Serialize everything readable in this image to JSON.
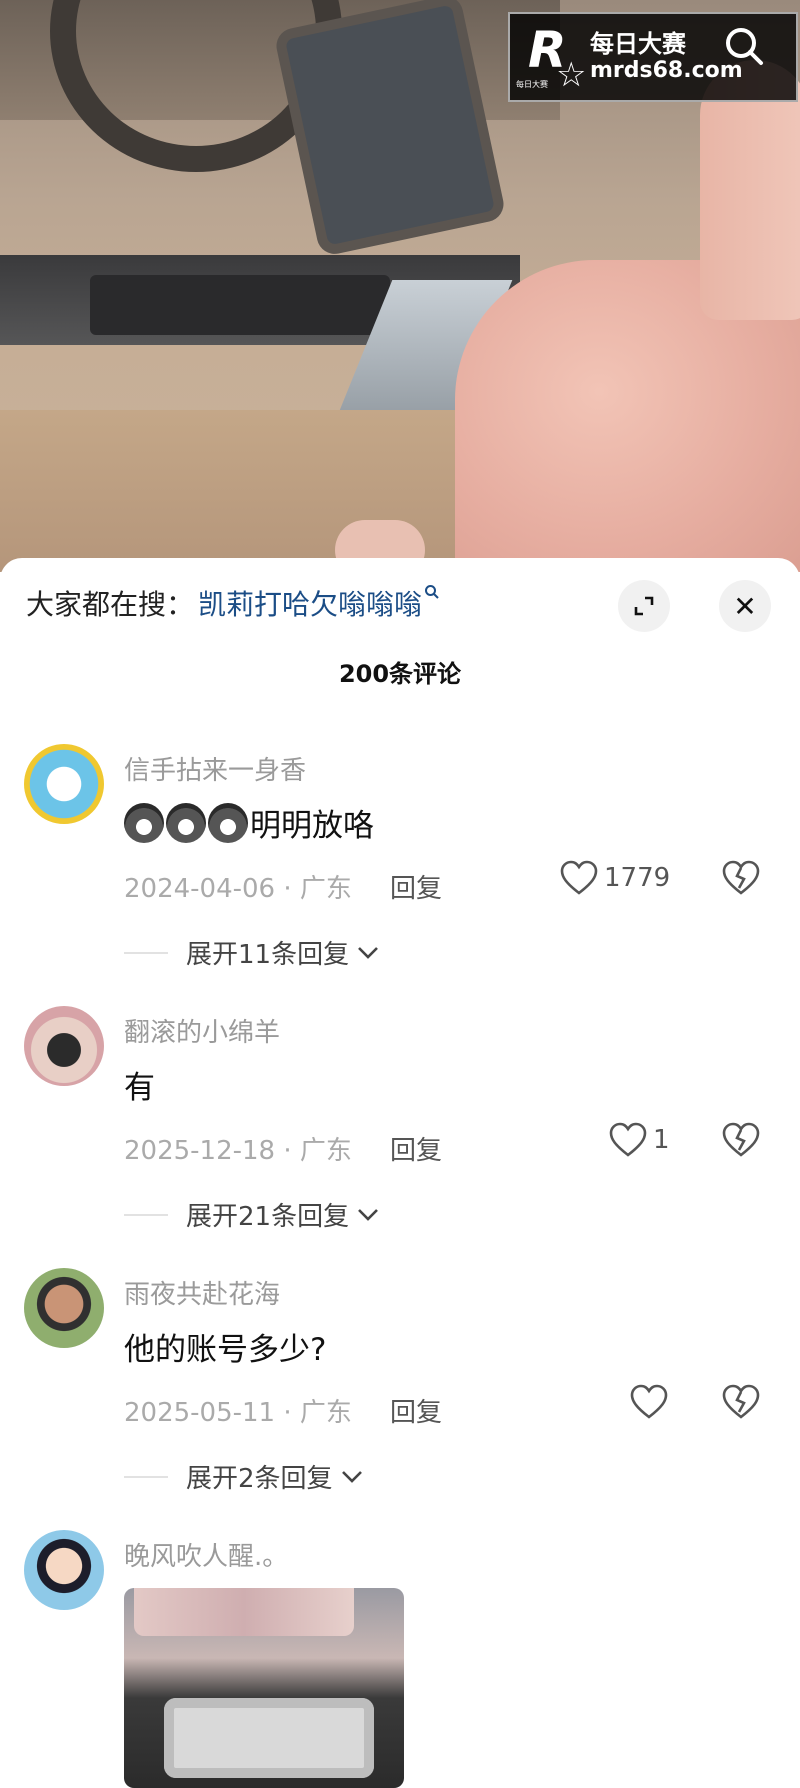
{
  "watermark": {
    "cn_text": "每日大赛",
    "url": "mrds68.com",
    "logo_letter": "R",
    "logo_small": "每日大赛"
  },
  "top_bar": {
    "search_icon": "search-icon"
  },
  "sheet": {
    "hot_search_label": "大家都在搜：",
    "hot_search_link": "凯莉打哈欠嗡嗡嗡",
    "comment_count": "200条评论",
    "expand_icon": "expand-icon",
    "close_icon": "close-icon",
    "close_glyph": "✕"
  },
  "comments": [
    {
      "username": "信手拈来一身香",
      "emojis": [
        "wolf-emoji",
        "wolf-emoji",
        "wolf-emoji"
      ],
      "text": "明明放咯",
      "meta": "2024-04-06 · 广东",
      "reply": "回复",
      "likes": "1779",
      "expand": "展开11条回复"
    },
    {
      "username": "翻滚的小绵羊",
      "text": "有",
      "meta": "2025-12-18 · 广东",
      "reply": "回复",
      "likes": "1",
      "expand": "展开21条回复"
    },
    {
      "username": "雨夜共赴花海",
      "text": "他的账号多少?",
      "meta": "2025-05-11 · 广东",
      "reply": "回复",
      "likes": "",
      "expand": "展开2条回复"
    },
    {
      "username": "晚风吹人醒.。",
      "media": "image-attachment"
    }
  ]
}
